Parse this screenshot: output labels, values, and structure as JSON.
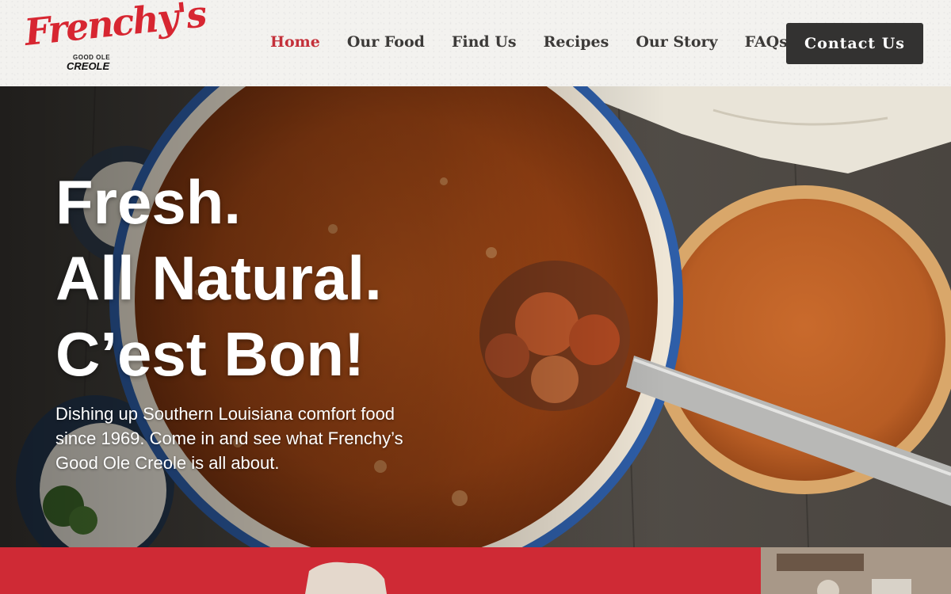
{
  "logo": {
    "script": "Frenchy's",
    "line1": "GOOD OLE",
    "line2": "CREOLE"
  },
  "nav": {
    "items": [
      {
        "label": "Home",
        "active": true
      },
      {
        "label": "Our Food",
        "active": false
      },
      {
        "label": "Find Us",
        "active": false
      },
      {
        "label": "Recipes",
        "active": false
      },
      {
        "label": "Our Story",
        "active": false
      },
      {
        "label": "FAQs",
        "active": false
      }
    ],
    "contact_label": "Contact Us"
  },
  "hero": {
    "heading_lines": [
      "Fresh.",
      "All Natural.",
      "C’est Bon!"
    ],
    "subtext": "Dishing up Southern Louisiana comfort food since 1969. Come in and see what Frenchy’s Good Ole Creole is all about.",
    "image_icon": "gumbo-and-pie-photo"
  },
  "colors": {
    "brand_red": "#d72631",
    "nav_active": "#c4303a",
    "nav_text": "#3c3a38",
    "button_bg": "#333231",
    "bottom_red": "#cf2a35"
  }
}
